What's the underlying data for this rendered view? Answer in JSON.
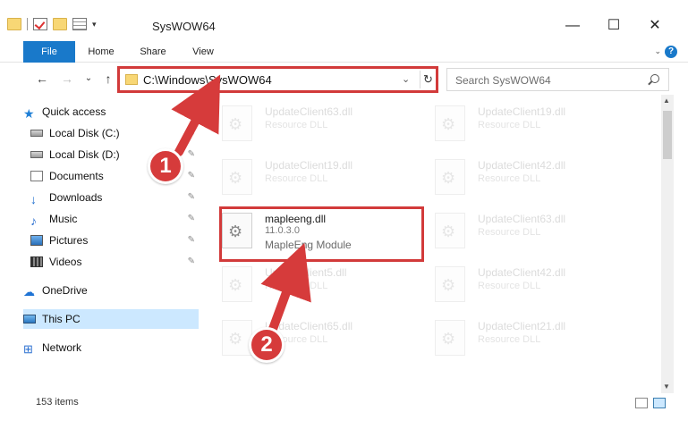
{
  "window": {
    "title": "SysWOW64",
    "controls": {
      "minimize": "—",
      "maximize": "☐",
      "close": "✕"
    }
  },
  "ribbon": {
    "tabs": [
      "File",
      "Home",
      "Share",
      "View"
    ],
    "expand_caret": "⌄",
    "help": "?"
  },
  "navigation": {
    "back": "←",
    "forward": "→",
    "recent": "⌄",
    "up": "↑",
    "address": "C:\\Windows\\SysWOW64",
    "address_dropdown": "⌄",
    "refresh": "↻",
    "search_placeholder": "Search SysWOW64"
  },
  "sidebar": {
    "items": [
      {
        "label": "Quick access",
        "icon": "star-icon",
        "pinned": false
      },
      {
        "label": "Local Disk (C:)",
        "icon": "disk-icon",
        "pinned": true
      },
      {
        "label": "Local Disk (D:)",
        "icon": "disk-icon",
        "pinned": true
      },
      {
        "label": "Documents",
        "icon": "documents-icon",
        "pinned": true
      },
      {
        "label": "Downloads",
        "icon": "downloads-icon",
        "pinned": true
      },
      {
        "label": "Music",
        "icon": "music-icon",
        "pinned": true
      },
      {
        "label": "Pictures",
        "icon": "pictures-icon",
        "pinned": true
      },
      {
        "label": "Videos",
        "icon": "videos-icon",
        "pinned": true
      },
      {
        "label": "OneDrive",
        "icon": "onedrive-icon",
        "pinned": false
      },
      {
        "label": "This PC",
        "icon": "this-pc-icon",
        "pinned": false,
        "selected": true
      },
      {
        "label": "Network",
        "icon": "network-icon",
        "pinned": false
      }
    ],
    "pin_glyph": "📌"
  },
  "files": {
    "left": [
      {
        "name": "UpdateClient63.dll",
        "desc": "Resource DLL"
      },
      {
        "name": "UpdateClient19.dll",
        "desc": "Resource DLL"
      },
      {
        "name": "mapleeng.dll",
        "version": "11.0.3.0",
        "desc": "MapleEng Module",
        "highlighted": true
      },
      {
        "name": "UpdateClient5.dll",
        "desc": "Resource DLL"
      },
      {
        "name": "UpdateClient65.dll",
        "desc": "Resource DLL"
      }
    ],
    "right": [
      {
        "name": "UpdateClient19.dll",
        "desc": "Resource DLL"
      },
      {
        "name": "UpdateClient42.dll",
        "desc": "Resource DLL"
      },
      {
        "name": "UpdateClient63.dll",
        "desc": "Resource DLL"
      },
      {
        "name": "UpdateClient42.dll",
        "desc": "Resource DLL"
      },
      {
        "name": "UpdateClient21.dll",
        "desc": "Resource DLL"
      }
    ]
  },
  "status": {
    "item_count": "153 items"
  },
  "annotations": {
    "step1": "1",
    "step2": "2",
    "highlight_color": "#d23a3a"
  },
  "colors": {
    "accent": "#1979ca",
    "selection": "#cce8ff"
  }
}
